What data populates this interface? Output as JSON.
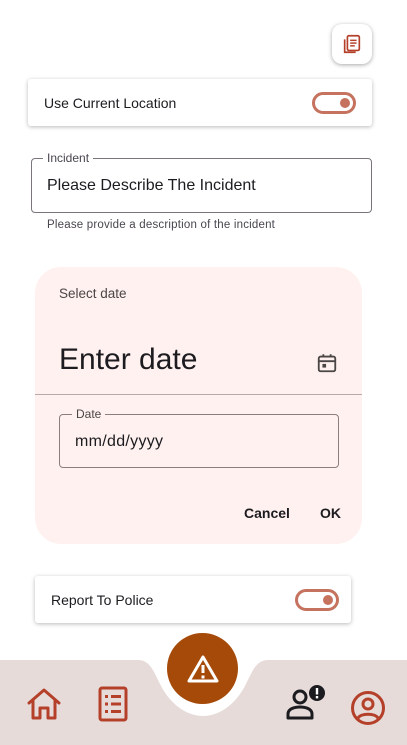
{
  "toolbar": {
    "copy_icon": "copy-icon"
  },
  "location": {
    "label": "Use Current Location",
    "enabled": true
  },
  "incident": {
    "label": "Incident",
    "value": "Please Describe The Incident",
    "helper": "Please provide a description of the incident"
  },
  "date_picker": {
    "title": "Select date",
    "headline": "Enter date",
    "field_label": "Date",
    "field_value": "mm/dd/yyyy",
    "cancel_label": "Cancel",
    "ok_label": "OK"
  },
  "police": {
    "label": "Report To Police",
    "enabled": true
  },
  "nav": {
    "items": [
      "home-icon",
      "list-icon",
      "alert-fab-icon",
      "person-alert-icon",
      "account-circle-icon"
    ]
  },
  "colors": {
    "accent": "#c5735f",
    "nav_icon": "#b5402a",
    "fab": "#a64a09",
    "nav_bar": "#e6dbd8",
    "dialog_bg": "#fff1ef"
  }
}
